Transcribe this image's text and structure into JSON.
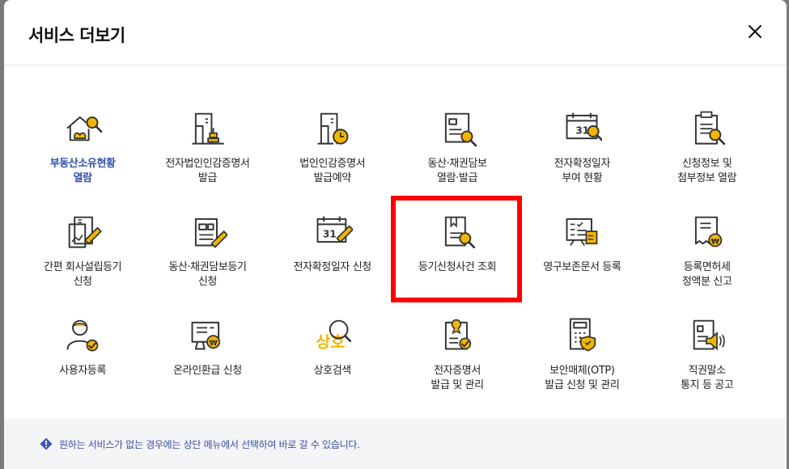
{
  "modal": {
    "title": "서비스 더보기",
    "close_icon": "close-icon"
  },
  "colors": {
    "accent": "#f2b600",
    "line": "#333333",
    "active_text": "#2f4fb0",
    "highlight": "#ff0000"
  },
  "services": [
    {
      "id": "property-status",
      "label": "부동산소유현황\n열람",
      "icon": "house-search-icon",
      "active": true
    },
    {
      "id": "corp-seal-cert",
      "label": "전자법인인감증명서\n발급",
      "icon": "building-stamp-icon"
    },
    {
      "id": "corp-seal-reserve",
      "label": "법인인감증명서\n발급예약",
      "icon": "building-clock-icon"
    },
    {
      "id": "movable-collateral-view",
      "label": "동산·채권담보\n열람·발급",
      "icon": "document-search-icon"
    },
    {
      "id": "fixed-date-status",
      "label": "전자확정일자\n부여 현황",
      "icon": "calendar-search-icon"
    },
    {
      "id": "application-info",
      "label": "신청정보 및\n첨부정보 열람",
      "icon": "clipboard-search-icon"
    },
    {
      "id": "simple-company-reg",
      "label": "간편 회사설립등기\n신청",
      "icon": "document-chart-pen-icon"
    },
    {
      "id": "movable-collateral-reg",
      "label": "동산·채권담보등기\n신청",
      "icon": "document-pen-icon"
    },
    {
      "id": "fixed-date-apply",
      "label": "전자확정일자 신청",
      "icon": "calendar-pen-icon"
    },
    {
      "id": "registry-case-lookup",
      "label": "등기신청사건 조회",
      "icon": "book-search-icon",
      "highlighted": true
    },
    {
      "id": "permanent-docs",
      "label": "영구보존문서 등록",
      "icon": "document-list-icon"
    },
    {
      "id": "license-tax",
      "label": "등록면허세\n정액분 신고",
      "icon": "receipt-won-icon"
    },
    {
      "id": "user-register",
      "label": "사용자등록",
      "icon": "user-check-icon"
    },
    {
      "id": "online-refund",
      "label": "온라인환급 신청",
      "icon": "monitor-won-icon"
    },
    {
      "id": "trade-name-search",
      "label": "상호검색",
      "icon": "trade-name-search-icon",
      "icon_text": "상호"
    },
    {
      "id": "e-certificate",
      "label": "전자증명서\n발급 및 관리",
      "icon": "certificate-check-icon"
    },
    {
      "id": "otp-media",
      "label": "보안매체(OTP)\n발급 신청 및 관리",
      "icon": "otp-shield-icon"
    },
    {
      "id": "duty-cancel-notice",
      "label": "직권말소\n통지 등 공고",
      "icon": "document-speaker-icon"
    }
  ],
  "footer": {
    "info_icon": "info-diamond-icon",
    "note": "원하는 서비스가 없는 경우에는 상단 메뉴에서 선택하여 바로 갈 수 있습니다."
  }
}
